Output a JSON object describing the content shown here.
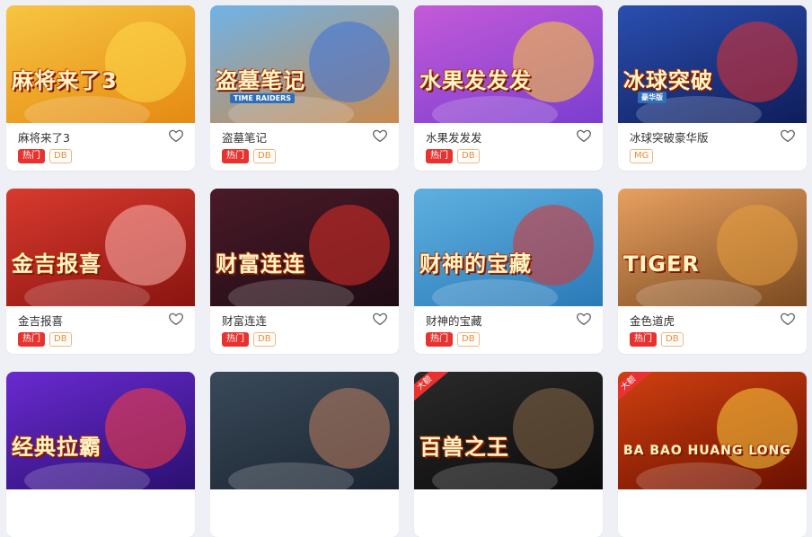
{
  "games": [
    {
      "name": "麻将来了3",
      "thumb_title": "麻将来了3",
      "tags": [
        "热门",
        "DB"
      ],
      "bg": [
        "#f7c542",
        "#e58a12"
      ],
      "accent": "#ffd84a"
    },
    {
      "name": "盗墓笔记",
      "thumb_title": "盗墓笔记",
      "thumb_sub": "TIME RAIDERS",
      "tags": [
        "热门",
        "DB"
      ],
      "bg": [
        "#6fb3e8",
        "#c98a4c"
      ],
      "accent": "#3b6fd8"
    },
    {
      "name": "水果发发发",
      "thumb_title": "水果发发发",
      "tags": [
        "热门",
        "DB"
      ],
      "bg": [
        "#c45ad8",
        "#7b3ed0"
      ],
      "accent": "#ffcc33"
    },
    {
      "name": "冰球突破豪华版",
      "thumb_title": "冰球突破",
      "thumb_sub": "豪华版",
      "tags": [
        "MG"
      ],
      "bg": [
        "#2a4fb0",
        "#0f1d5a"
      ],
      "accent": "#e8322f"
    },
    {
      "name": "金吉报喜",
      "thumb_title": "金吉报喜",
      "tags": [
        "热门",
        "DB"
      ],
      "bg": [
        "#d83a2e",
        "#8a1410"
      ],
      "accent": "#ffb6b0"
    },
    {
      "name": "财富连连",
      "thumb_title": "财富连连",
      "tags": [
        "热门",
        "DB"
      ],
      "bg": [
        "#4a1a28",
        "#1e0c14"
      ],
      "accent": "#e0302a"
    },
    {
      "name": "财神的宝藏",
      "thumb_title": "财神的宝藏",
      "tags": [
        "热门",
        "DB"
      ],
      "bg": [
        "#5fb0e0",
        "#2a7ab8"
      ],
      "accent": "#e0302a"
    },
    {
      "name": "金色道虎",
      "thumb_title": "TIGER",
      "tags": [
        "热门",
        "DB"
      ],
      "bg": [
        "#e8a060",
        "#7a4a20"
      ],
      "accent": "#e8a040"
    },
    {
      "name": "",
      "thumb_title": "经典拉霸",
      "tags": [],
      "bg": [
        "#6a2ad0",
        "#2a1070"
      ],
      "accent": "#ff4040"
    },
    {
      "name": "",
      "thumb_title": "",
      "tags": [],
      "bg": [
        "#3a4a5a",
        "#1a2430"
      ],
      "accent": "#c08060"
    },
    {
      "name": "",
      "thumb_title": "百兽之王",
      "corner": "大额",
      "tags": [],
      "bg": [
        "#2a2a2a",
        "#0a0a0a"
      ],
      "accent": "#8a6a4a"
    },
    {
      "name": "",
      "thumb_title": "BA BAO HUANG LONG",
      "corner": "大额",
      "tags": [],
      "bg": [
        "#d04010",
        "#6a1000"
      ],
      "accent": "#ffd040"
    }
  ]
}
